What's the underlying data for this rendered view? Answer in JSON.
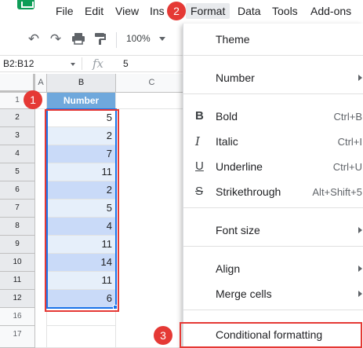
{
  "menubar": {
    "items": [
      "File",
      "Edit",
      "View",
      "Ins",
      "Format",
      "Data",
      "Tools",
      "Add-ons"
    ]
  },
  "toolbar": {
    "zoom": "100%"
  },
  "formula_bar": {
    "name_box": "B2:B12",
    "fx": "fx",
    "value": "5"
  },
  "grid": {
    "columns": [
      "A",
      "B",
      "C"
    ],
    "rows": [
      "1",
      "2",
      "3",
      "4",
      "5",
      "6",
      "7",
      "8",
      "9",
      "10",
      "11",
      "12",
      "16",
      "17"
    ],
    "header": "Number",
    "values": [
      "5",
      "2",
      "7",
      "11",
      "2",
      "5",
      "4",
      "11",
      "14",
      "11",
      "6"
    ]
  },
  "format_menu": {
    "theme": "Theme",
    "number": "Number",
    "bold": "Bold",
    "bold_shortcut": "Ctrl+B",
    "italic": "Italic",
    "italic_shortcut": "Ctrl+I",
    "underline": "Underline",
    "underline_shortcut": "Ctrl+U",
    "strikethrough": "Strikethrough",
    "strikethrough_shortcut": "Alt+Shift+5",
    "font_size": "Font size",
    "align": "Align",
    "merge_cells": "Merge cells",
    "conditional_formatting": "Conditional formatting"
  },
  "steps": [
    "1",
    "2",
    "3"
  ],
  "colors": {
    "accent_red": "#e53935",
    "selection_blue": "#1a73e8",
    "header_fill": "#6fa8dc"
  }
}
